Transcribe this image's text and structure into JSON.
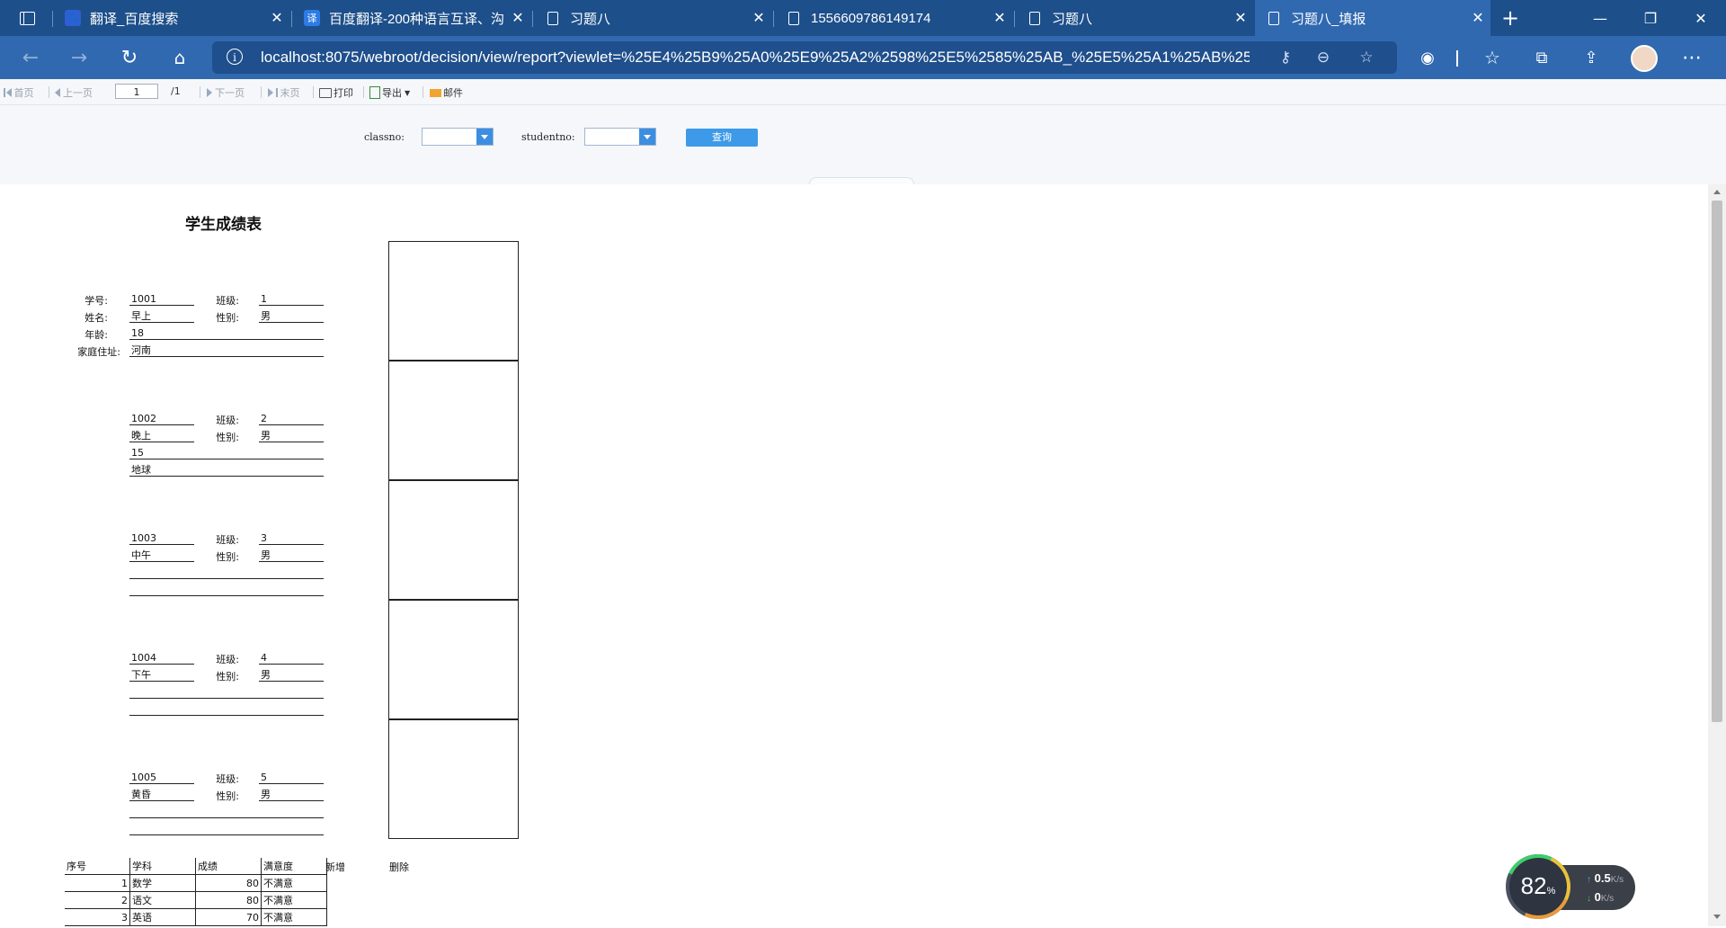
{
  "browser": {
    "tabs": [
      {
        "title": "翻译_百度搜索",
        "icon": "baidu-paw-icon"
      },
      {
        "title": "百度翻译-200种语言互译、沟",
        "icon": "baidu-translate-icon"
      },
      {
        "title": "习题八",
        "icon": "page-icon"
      },
      {
        "title": "1556609786149174",
        "icon": "page-icon"
      },
      {
        "title": "习题八",
        "icon": "page-icon"
      },
      {
        "title": "习题八_填报",
        "icon": "page-icon",
        "active": true
      }
    ],
    "url": "localhost:8075/webroot/decision/view/report?viewlet=%25E4%25B9%25A0%25E9%25A2%2598%25E5%2585%25AB_%25E5%25A1%25AB%25..."
  },
  "toolbar": {
    "first": "首页",
    "prev": "上一页",
    "page_value": "1",
    "page_total": "/1",
    "next": "下一页",
    "last": "末页",
    "print": "打印",
    "export": "导出",
    "mail": "邮件"
  },
  "params": {
    "classno_label": "classno:",
    "studentno_label": "studentno:",
    "query_button": "查询"
  },
  "report": {
    "title": "学生成绩表",
    "labels": {
      "student_no": "学号:",
      "name": "姓名:",
      "age": "年龄:",
      "address": "家庭住址:",
      "class": "班级:",
      "gender": "性别:"
    },
    "students": [
      {
        "no": "1001",
        "name": "早上",
        "age": "18",
        "address": "河南",
        "class": "1",
        "gender": "男"
      },
      {
        "no": "1002",
        "name": "晚上",
        "age": "15",
        "address": "地球",
        "class": "2",
        "gender": "男"
      },
      {
        "no": "1003",
        "name": "中午",
        "age": "",
        "address": "",
        "class": "3",
        "gender": "男"
      },
      {
        "no": "1004",
        "name": "下午",
        "age": "",
        "address": "",
        "class": "4",
        "gender": "男"
      },
      {
        "no": "1005",
        "name": "黄昏",
        "age": "",
        "address": "",
        "class": "5",
        "gender": "男"
      }
    ],
    "score_table": {
      "headers": [
        "序号",
        "学科",
        "成绩",
        "满意度"
      ],
      "add_label": "新增",
      "delete_label": "删除",
      "rows": [
        {
          "seq": "1",
          "subject": "数学",
          "score": "80",
          "satisfaction": "不满意"
        },
        {
          "seq": "2",
          "subject": "语文",
          "score": "80",
          "satisfaction": "不满意"
        },
        {
          "seq": "3",
          "subject": "英语",
          "score": "70",
          "satisfaction": "不满意"
        }
      ]
    }
  },
  "network_widget": {
    "percent": "82",
    "percent_unit": "%",
    "upload": "0.5",
    "upload_unit": "K/s",
    "download": "0",
    "download_unit": "K/s"
  },
  "colors": {
    "tabstrip": "#1d4f8a",
    "toolbar": "#3069b0",
    "query_button": "#3d9ae8"
  }
}
